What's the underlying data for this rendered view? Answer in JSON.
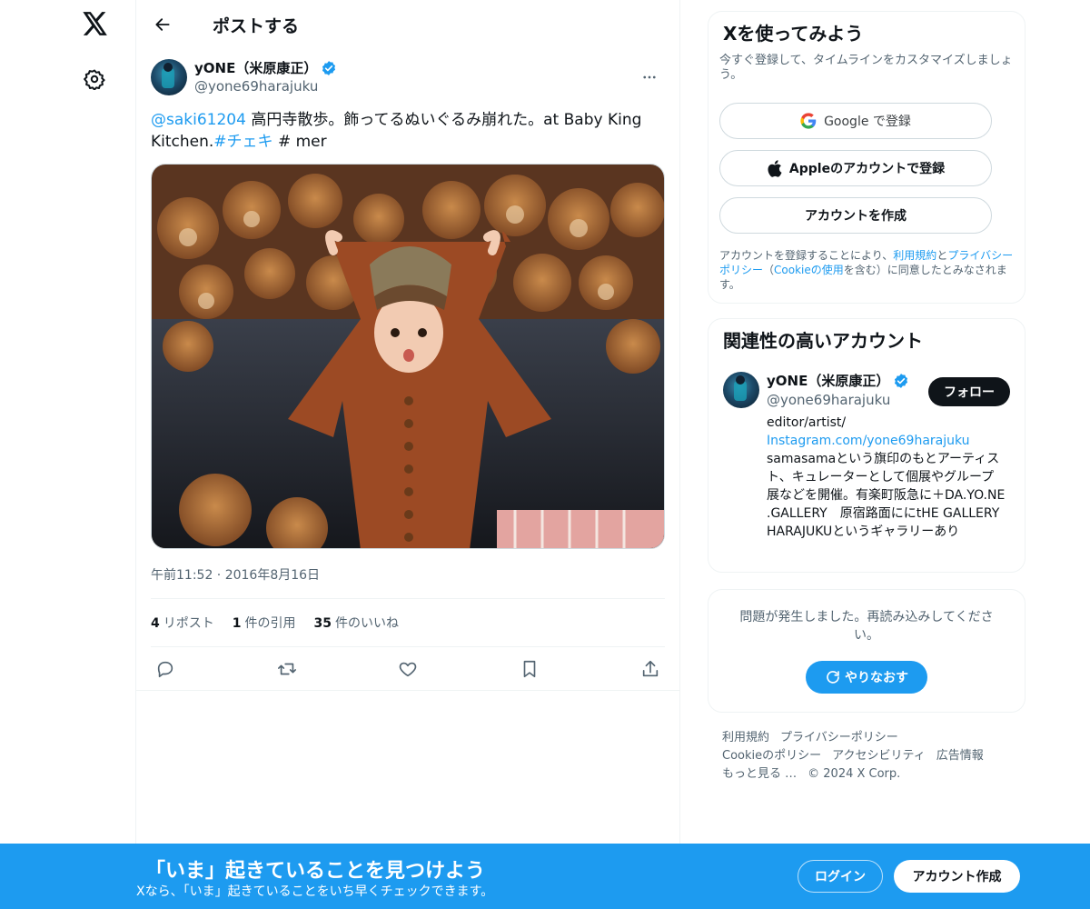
{
  "nav": {
    "logo_icon": "x-logo-icon",
    "settings_icon": "gear-icon"
  },
  "header": {
    "title": "ポストする"
  },
  "post": {
    "author": {
      "name": "yONE（米原康正）",
      "handle": "@yone69harajuku"
    },
    "text": {
      "mention": "@saki61204",
      "body": " 高円寺散歩。飾ってるぬいぐるみ崩れた。at Baby King Kitchen.",
      "hashtag": "#チェキ",
      "tail": " # mer"
    },
    "timestamp": "午前11:52 · 2016年8月16日",
    "stats": [
      {
        "count": "4",
        "label": "リポスト"
      },
      {
        "count": "1",
        "label": "件の引用"
      },
      {
        "count": "35",
        "label": "件のいいね"
      }
    ]
  },
  "signup": {
    "title": "Xを使ってみよう",
    "subtitle": "今すぐ登録して、タイムラインをカスタマイズしましょう。",
    "google_label": "Google で登録",
    "apple_label": "Appleのアカウントで登録",
    "create_label": "アカウントを作成",
    "legal_pre": "アカウントを登録することにより、",
    "legal_terms": "利用規約",
    "legal_and": "と",
    "legal_privacy": "プライバシーポリシー",
    "legal_paren_open": "（",
    "legal_cookie": "Cookieの使用",
    "legal_post": "を含む）に同意したとみなされます。"
  },
  "related": {
    "title": "関連性の高いアカウント",
    "name": "yONE（米原康正）",
    "handle": "@yone69harajuku",
    "follow_label": "フォロー",
    "bio_1": "editor/artist/",
    "bio_link": "Instagram.com/yone69harajuku",
    "bio_2": "samasamaという旗印のもとアーティスト、キュレーターとして個展やグループ展などを開催。有楽町阪急に＋DA.YO.NE .GALLERY　原宿路面ににtHE GALLERY HARAJUKUというギャラリーあり"
  },
  "error": {
    "message": "問題が発生しました。再読み込みしてください。",
    "retry_label": "やりなおす"
  },
  "footer": {
    "links_1": [
      "利用規約",
      "プライバシーポリシー"
    ],
    "links_2": [
      "Cookieのポリシー",
      "アクセシビリティ",
      "広告情報"
    ],
    "more": "もっと見る …",
    "copyright": "© 2024 X Corp."
  },
  "banner": {
    "title": "「いま」起きていることを見つけよう",
    "subtitle": "Xなら、「いま」起きていることをいち早くチェックできます。",
    "login_label": "ログイン",
    "create_label": "アカウント作成"
  },
  "colors": {
    "accent": "#1d9bf0",
    "text": "#0f1419",
    "muted": "#536471"
  }
}
